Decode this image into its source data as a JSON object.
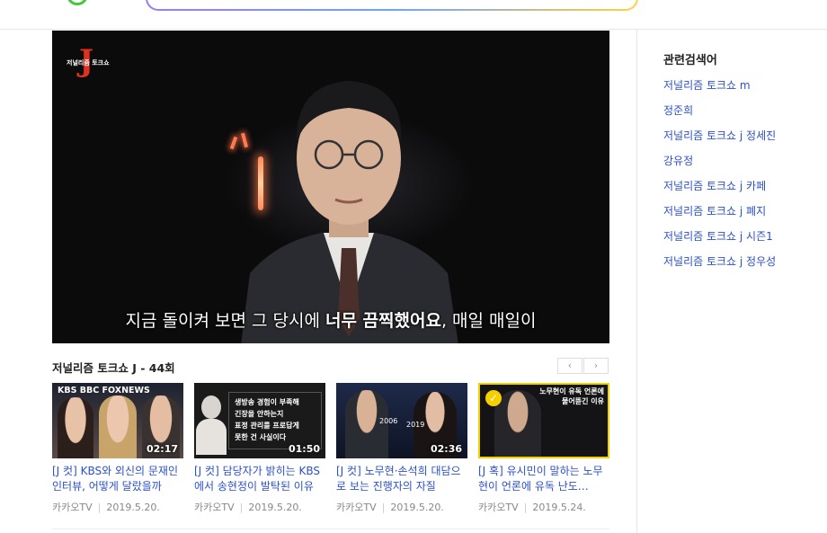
{
  "video": {
    "channel_logo_text": "저널리즘 토크쇼",
    "channel_logo_letter": "J",
    "subtitle_pre": "지금 돌이켜 보면 그 당시에 ",
    "subtitle_bold": "너무 끔찍했어요",
    "subtitle_post": ", 매일 매일이"
  },
  "playlist": {
    "title": "저널리즘 토크쇼 J - 44회",
    "prev_label": "‹",
    "next_label": "›",
    "items": [
      {
        "title": "[J 컷] KBS와 외신의 문재인 인터뷰, 어떻게 달랐을까",
        "duration": "02:17",
        "source": "카카오TV",
        "date": "2019.5.20.",
        "thumb_text_top": "KBS  BBC  FOXNEWS"
      },
      {
        "title": "[J 컷] 담당자가 밝히는 KBS에서 송현정이 발탁된 이유",
        "duration": "01:50",
        "source": "카카오TV",
        "date": "2019.5.20.",
        "thumb_caption_1": "생방송 경험이 부족해",
        "thumb_caption_2": "긴장을 안하는지",
        "thumb_caption_3": "표정 관리를 프로답게",
        "thumb_caption_4": "못한 건 사실이다"
      },
      {
        "title": "[J 컷] 노무현·손석희 대담으로 보는 진행자의 자질",
        "duration": "02:36",
        "source": "카카오TV",
        "date": "2019.5.20.",
        "thumb_year_1": "2006",
        "thumb_year_2": "2019"
      },
      {
        "title": "[J 혹] 유시민이 말하는 노무현이 언론에 유독 난도…",
        "duration": "",
        "source": "카카오TV",
        "date": "2019.5.24.",
        "thumb_caption_1": "노무현이 유독 언론에",
        "thumb_caption_2": "물어뜯긴 이유"
      }
    ]
  },
  "related": {
    "heading": "관련검색어",
    "items": [
      "저널리즘 토크쇼 m",
      "정준희",
      "저널리즘 토크쇼 j 정세진",
      "강유정",
      "저널리즘 토크쇼 j 카페",
      "저널리즘 토크쇼 j 폐지",
      "저널리즘 토크쇼 j 시즌1",
      "저널리즘 토크쇼 j 정우성"
    ]
  },
  "colors": {
    "link": "#2b50c8",
    "accent_yellow": "#f5d000",
    "logo_red": "#e0311f"
  }
}
